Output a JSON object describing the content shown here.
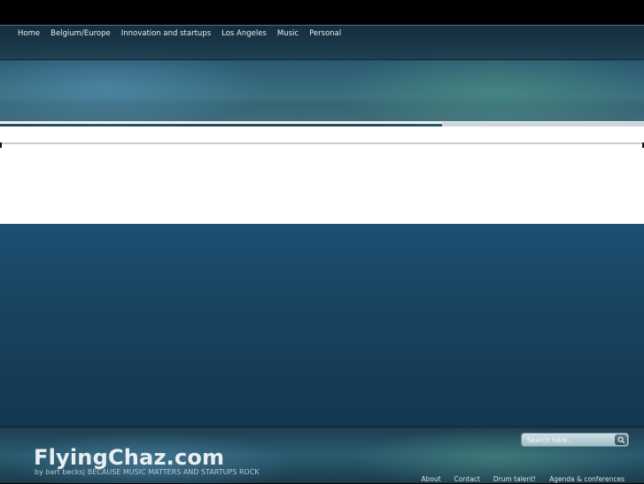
{
  "nav": {
    "items": [
      "Home",
      "Belgium/Europe",
      "Innovation and startups",
      "Los Angeles",
      "Music",
      "Personal"
    ]
  },
  "footer": {
    "brand": "FlyingChaz.com",
    "tagline": "by bart becks| BECAUSE MUSIC MATTERS AND STARTUPS ROCK",
    "search_placeholder": "Search here...",
    "links": [
      "About",
      "Contact",
      "Drum talent!",
      "Agenda & conferences"
    ]
  },
  "colors": {
    "header_teal": "#2c5c74",
    "content_blue": "#1d4f72",
    "nav_text": "#e8eef2"
  }
}
